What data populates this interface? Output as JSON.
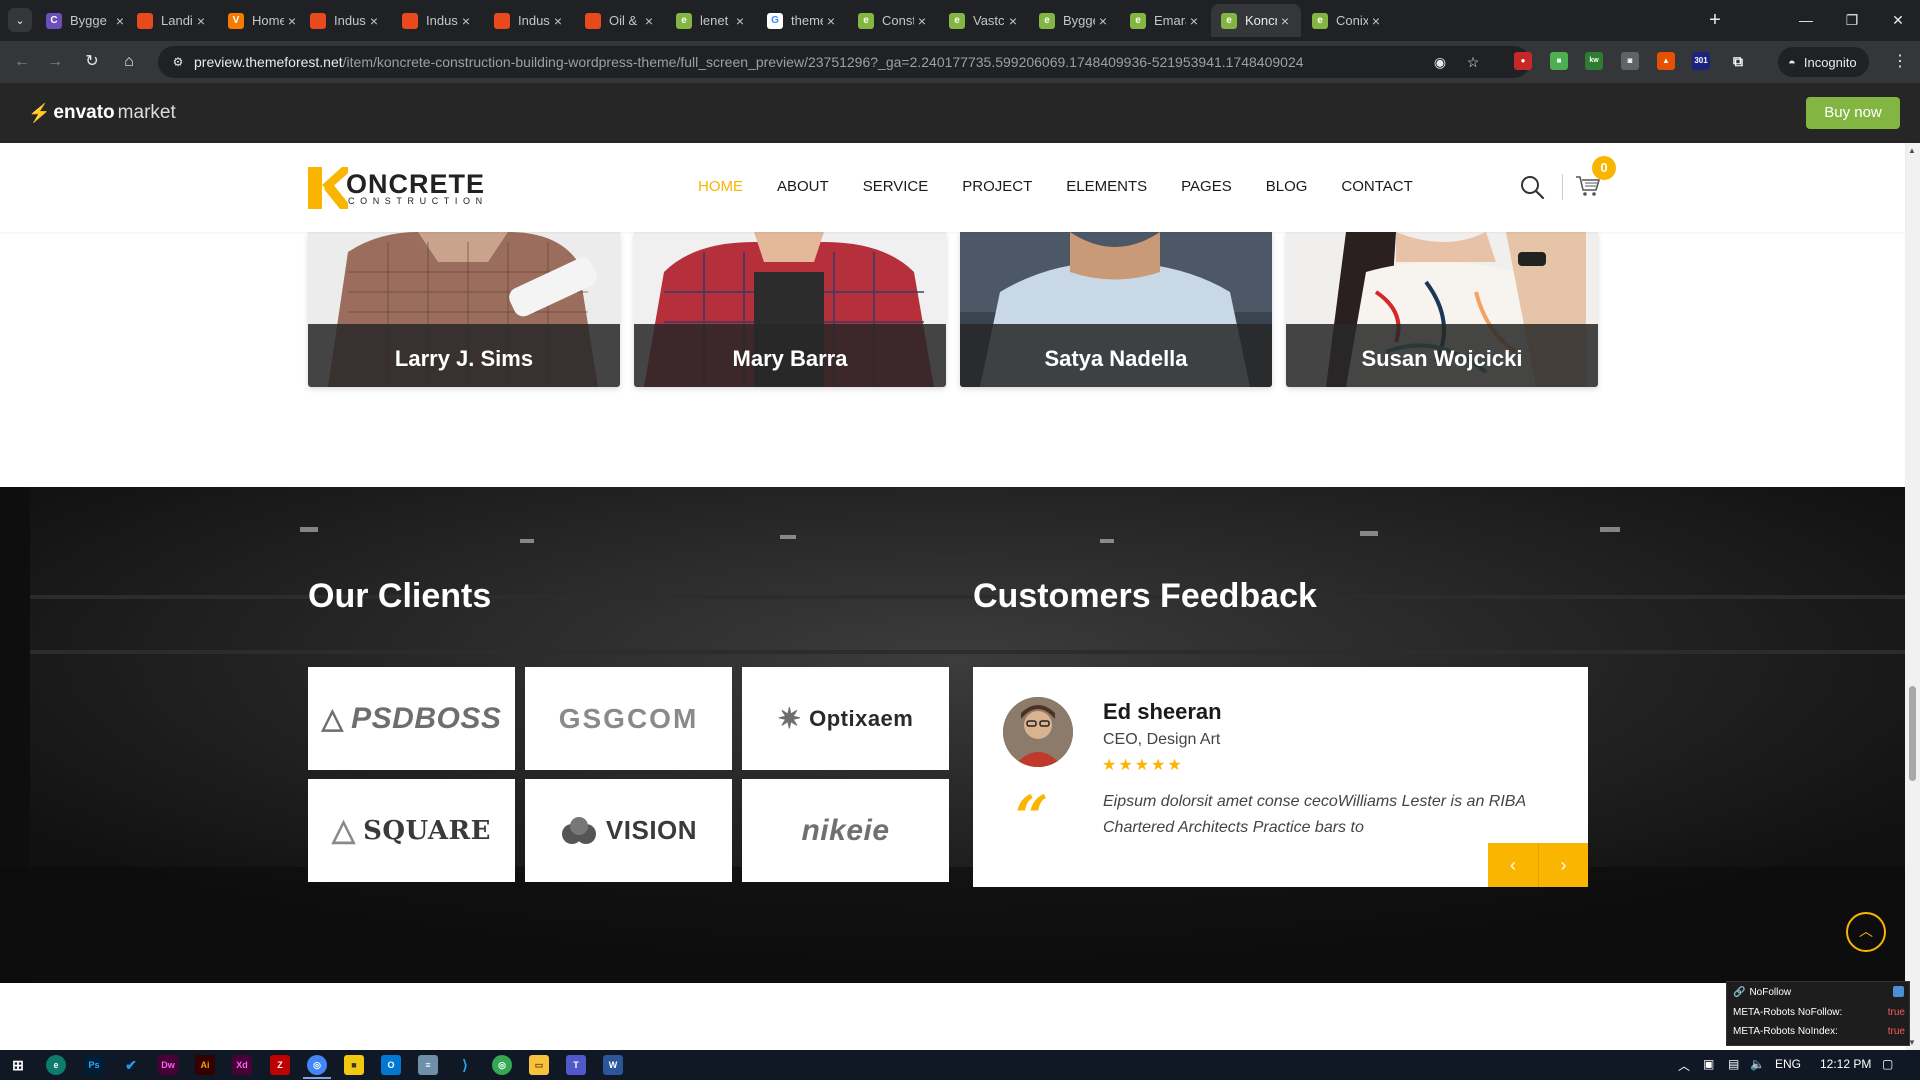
{
  "browser": {
    "tabs": [
      {
        "label": "Bygge",
        "color": "#6b4fbb",
        "glyph": "C"
      },
      {
        "label": "Landin",
        "color": "#e8491d",
        "glyph": "▮"
      },
      {
        "label": "Home",
        "color": "#f57c00",
        "glyph": "V"
      },
      {
        "label": "Industr",
        "color": "#e8491d",
        "glyph": "▮"
      },
      {
        "label": "Industr",
        "color": "#e8491d",
        "glyph": "▮"
      },
      {
        "label": "Industr",
        "color": "#e8491d",
        "glyph": "▮"
      },
      {
        "label": "Oil & G",
        "color": "#e8491d",
        "glyph": "▮"
      },
      {
        "label": "lenet -",
        "color": "#82b541",
        "glyph": "e"
      },
      {
        "label": "themef",
        "color": "#4285f4",
        "glyph": "G"
      },
      {
        "label": "Constr",
        "color": "#82b541",
        "glyph": "e"
      },
      {
        "label": "Vastcor",
        "color": "#82b541",
        "glyph": "e"
      },
      {
        "label": "Bygge",
        "color": "#82b541",
        "glyph": "e"
      },
      {
        "label": "Emarat",
        "color": "#82b541",
        "glyph": "e"
      },
      {
        "label": "Koncre",
        "color": "#82b541",
        "glyph": "e",
        "active": true
      },
      {
        "label": "Conix -",
        "color": "#82b541",
        "glyph": "e"
      }
    ],
    "new_tab": "+",
    "url_host": "preview.themeforest.net",
    "url_path": "/item/koncrete-construction-building-wordpress-theme/full_screen_preview/23751296?_ga=2.240177735.599206069.1748409936-521953941.1748409024",
    "incognito_label": "Incognito",
    "ext_badge": "301"
  },
  "envato": {
    "logo_brand": "envato",
    "logo_market": "market",
    "buy_now": "Buy now"
  },
  "site": {
    "logo_word": "ONCRETE",
    "logo_sub": "CONSTRUCTION",
    "nav": [
      "HOME",
      "ABOUT",
      "SERVICE",
      "PROJECT",
      "ELEMENTS",
      "PAGES",
      "BLOG",
      "CONTACT"
    ],
    "active_nav": "HOME",
    "cart_count": "0"
  },
  "team": [
    {
      "name": "Larry J. Sims"
    },
    {
      "name": "Mary Barra"
    },
    {
      "name": "Satya Nadella"
    },
    {
      "name": "Susan Wojcicki"
    }
  ],
  "clients": {
    "title": "Our Clients",
    "logos": [
      "PSDBOSS",
      "GSGCOM",
      "Optixaem",
      "SQUARE",
      "VISION",
      "nikeie"
    ]
  },
  "feedback": {
    "title": "Customers Feedback",
    "name": "Ed sheeran",
    "role": "CEO, Design Art",
    "rating": 5,
    "stars": "★★★★★",
    "text": "Eipsum dolorsit amet conse cecoWilliams Lester is an RIBA Chartered Architects Practice bars to",
    "prev": "‹",
    "next": "›"
  },
  "nofollow_panel": {
    "title": "NoFollow",
    "rows": [
      {
        "key": "META-Robots NoFollow:",
        "value": "true"
      },
      {
        "key": "META-Robots NoIndex:",
        "value": "true"
      }
    ]
  },
  "taskbar": {
    "lang": "ENG",
    "time": "12:12 PM"
  },
  "colors": {
    "accent": "#f9b500",
    "envato_green": "#82b541",
    "dark_section": "#161616"
  }
}
